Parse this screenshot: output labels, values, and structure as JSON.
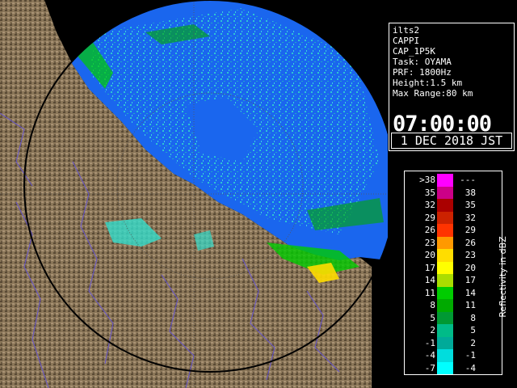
{
  "info": {
    "site": "ilts2",
    "product": "CAPPI",
    "scan": "CAP_1P5K",
    "task": "Task: OYAMA",
    "prf": "PRF: 1800Hz",
    "height": "Height:1.5 km",
    "max_range": "Max Range:80 km",
    "time": "07:00:00",
    "date": "1 DEC 2018 JST"
  },
  "legend": {
    "axis_label": "Reflectivity in dBZ",
    "rows": [
      {
        "lo": ">38",
        "hi": "---",
        "color": "#ff00ff"
      },
      {
        "lo": "35",
        "hi": "38",
        "color": "#cc0088"
      },
      {
        "lo": "32",
        "hi": "35",
        "color": "#aa0000"
      },
      {
        "lo": "29",
        "hi": "32",
        "color": "#cc2200"
      },
      {
        "lo": "26",
        "hi": "29",
        "color": "#ff3300"
      },
      {
        "lo": "23",
        "hi": "26",
        "color": "#ff9900"
      },
      {
        "lo": "20",
        "hi": "23",
        "color": "#ffdd00"
      },
      {
        "lo": "17",
        "hi": "20",
        "color": "#ffff00"
      },
      {
        "lo": "14",
        "hi": "17",
        "color": "#aadd00"
      },
      {
        "lo": "11",
        "hi": "14",
        "color": "#00cc00"
      },
      {
        "lo": "8",
        "hi": "11",
        "color": "#00aa00"
      },
      {
        "lo": "5",
        "hi": "8",
        "color": "#009933"
      },
      {
        "lo": "2",
        "hi": "5",
        "color": "#00bb88"
      },
      {
        "lo": "-1",
        "hi": "2",
        "color": "#00aa99"
      },
      {
        "lo": "-4",
        "hi": "-1",
        "color": "#00dddd"
      },
      {
        "lo": "-7",
        "hi": "-4",
        "color": "#00ffff"
      }
    ]
  },
  "colors": {
    "land": "#8a7658",
    "sea": "#000000",
    "radar_fill": "#1a66ee",
    "weak_echo": "#33ddcc",
    "rivers": "#6655cc",
    "range_ring": "#444444"
  }
}
